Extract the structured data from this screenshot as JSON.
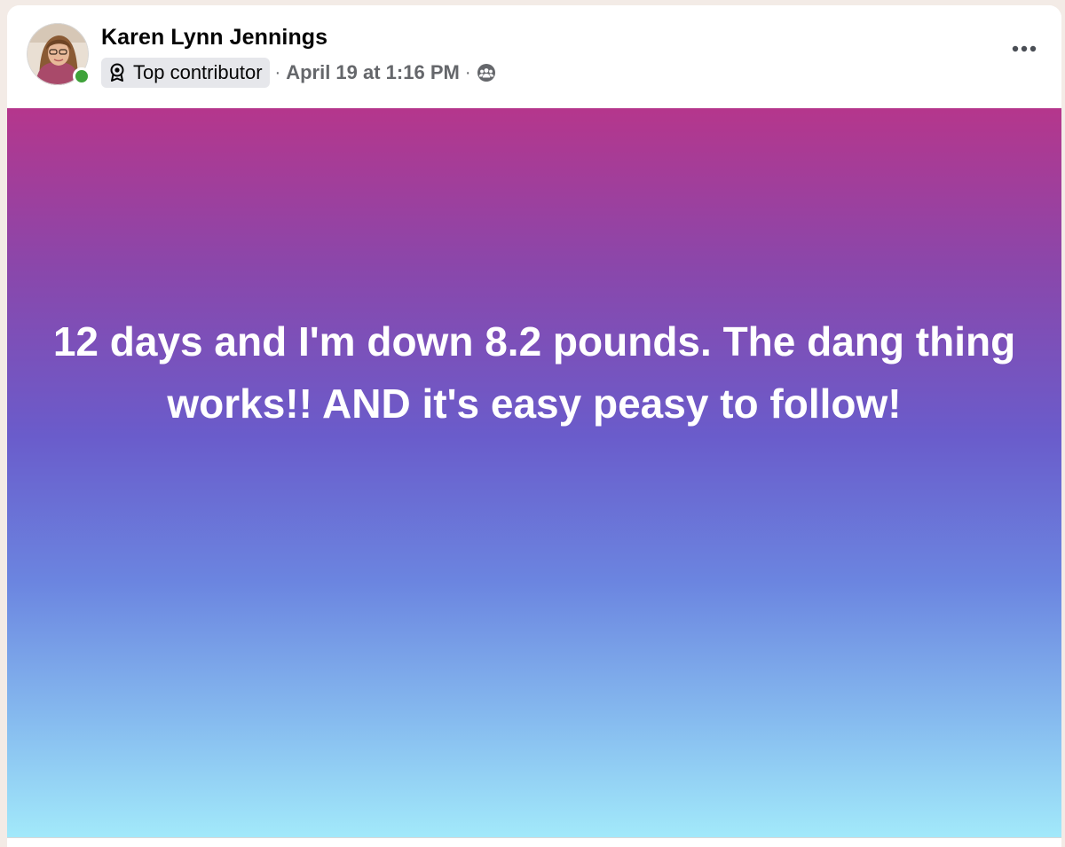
{
  "post": {
    "author_name": "Karen Lynn Jennings",
    "badge_label": "Top contributor",
    "badge_icon": "award-icon",
    "separator": "·",
    "timestamp": "April 19 at 1:16 PM",
    "audience_icon": "group-audience-icon",
    "more_icon": "more-options-icon",
    "online_status_color": "#3fa23a",
    "body_text": "12 days and I'm down 8.2 pounds. The dang thing works!! AND it's easy peasy to follow!",
    "background_gradient": [
      "#b5368c",
      "#8a47ab",
      "#6a5ccb",
      "#6b85e0",
      "#86bbef",
      "#a2e9fa"
    ],
    "text_color": "#ffffff"
  }
}
